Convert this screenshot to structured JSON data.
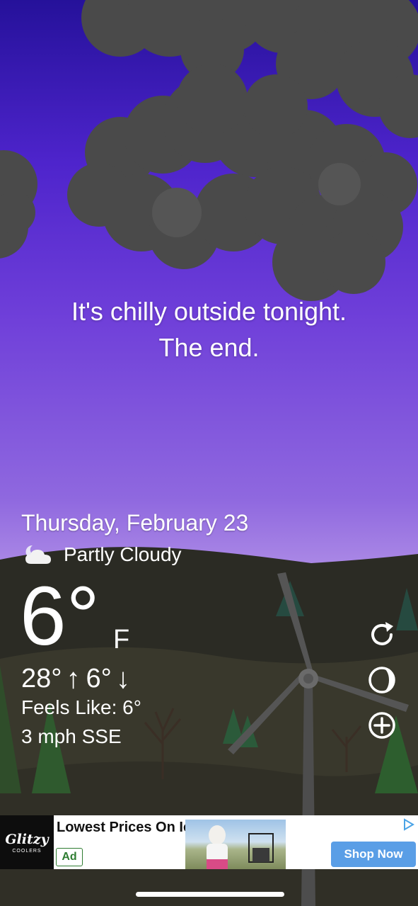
{
  "headline": {
    "line1": "It's chilly outside tonight.",
    "line2": "The end."
  },
  "weather": {
    "date": "Thursday, February 23",
    "condition": "Partly Cloudy",
    "condition_icon": "partly-cloudy-night-icon",
    "temperature": "6°",
    "unit": "F",
    "high": "28°",
    "low": "6°",
    "feels_like": "Feels Like: 6°",
    "wind": "3 mph SSE"
  },
  "controls": [
    {
      "name": "refresh-icon"
    },
    {
      "name": "moon-phase-icon"
    },
    {
      "name": "add-location-icon"
    }
  ],
  "ad": {
    "logo_text": "Glitzy",
    "logo_sub": "COOLERS",
    "title": "Lowest Prices On Ice Cooler",
    "badge": "Ad",
    "cta": "Shop Now"
  },
  "colors": {
    "sky_top": "#25119a",
    "sky_bottom": "#b9a0e9",
    "cloud": "#4a4a4a",
    "ground": "#2a2a22",
    "cta": "#5a9ee6"
  }
}
